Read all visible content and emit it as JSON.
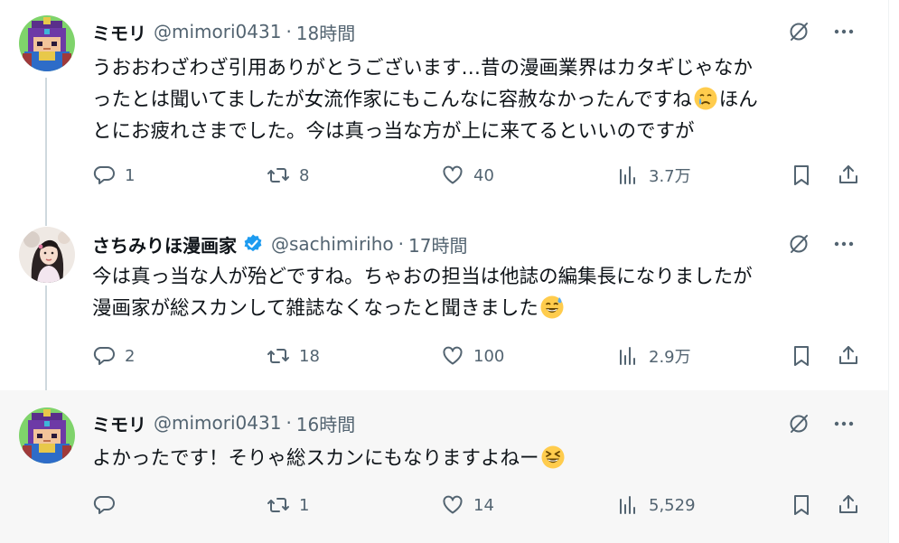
{
  "colors": {
    "text": "#0f1419",
    "muted": "#536471",
    "verified": "#1d9bf0",
    "thread_line": "#cfd9de",
    "highlight_bg": "#f7f7f7"
  },
  "tweets": [
    {
      "name": "ミモリ",
      "handle": "@mimori0431",
      "sep": "·",
      "time": "18時間",
      "avatar_icon": "pixel-knight-avatar",
      "lines": [
        {
          "text": "うおおわざわざ引用ありがとうございます…昔の漫画業界はカタギじゃなか"
        },
        {
          "text": "ったとは聞いてましたが女流作家にもこんなに容赦なかったんですね",
          "emoji": "crying-face-emoji",
          "after": "ほん"
        },
        {
          "text": "とにお疲れさまでした。今は真っ当な方が上に来てるといいのですが"
        }
      ],
      "stats": {
        "replies": "1",
        "reposts": "8",
        "likes": "40",
        "views": "3.7万"
      }
    },
    {
      "name": "さちみりほ漫画家",
      "handle": "@sachimiriho",
      "sep": "·",
      "time": "17時間",
      "verified": true,
      "avatar_icon": "photo-avatar",
      "lines": [
        {
          "text": "今は真っ当な人が殆どですね。ちゃおの担当は他誌の編集長になりましたが"
        },
        {
          "text": "漫画家が総スカンして雑誌なくなったと聞きました",
          "emoji": "grinning-sweat-emoji"
        }
      ],
      "stats": {
        "replies": "2",
        "reposts": "18",
        "likes": "100",
        "views": "2.9万"
      }
    },
    {
      "name": "ミモリ",
      "handle": "@mimori0431",
      "sep": "·",
      "time": "16時間",
      "avatar_icon": "pixel-knight-avatar",
      "lines": [
        {
          "text": "よかったです！そりゃ総スカンにもなりますよねー",
          "emoji": "squinting-laugh-emoji"
        }
      ],
      "stats": {
        "replies": "",
        "reposts": "1",
        "likes": "14",
        "views": "5,529"
      }
    }
  ]
}
